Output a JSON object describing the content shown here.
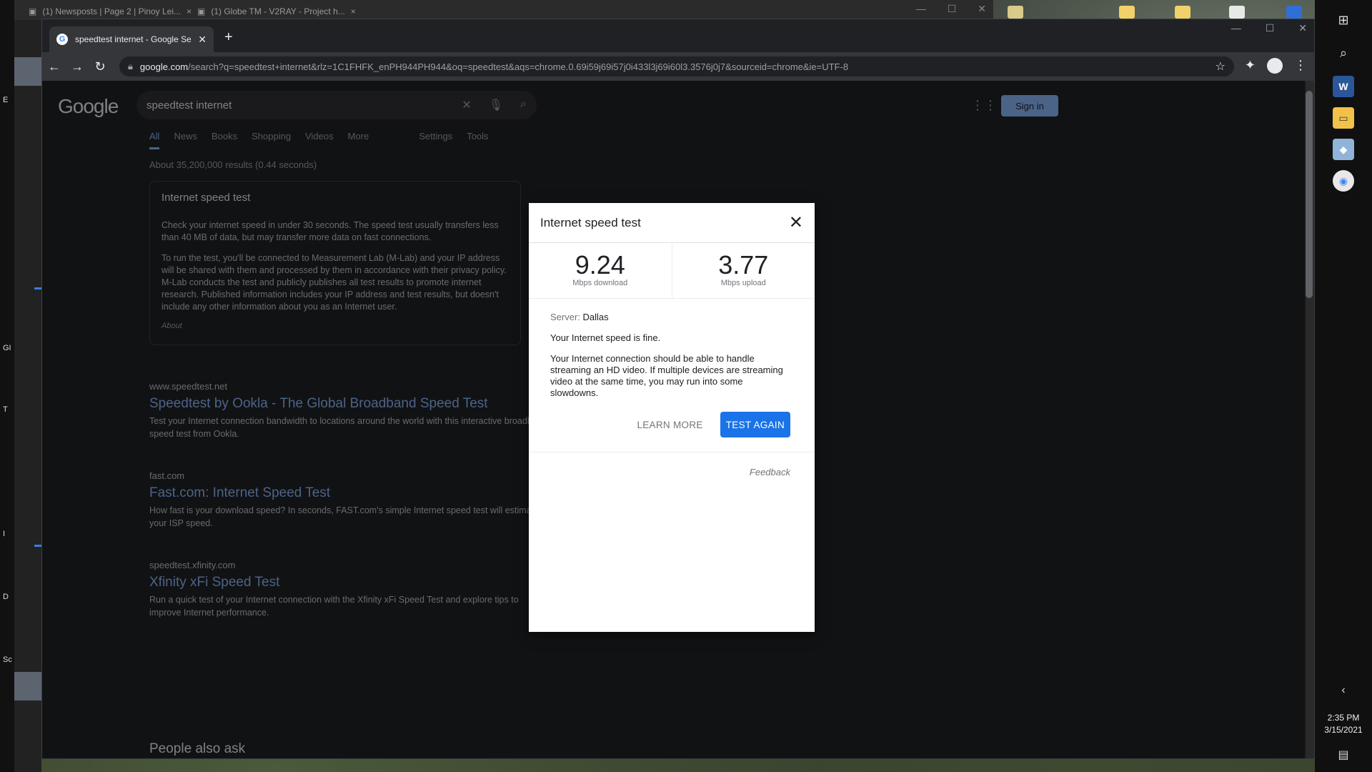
{
  "background_window": {
    "tabs": [
      "(1) Newsposts | Page 2 | Pinoy Lei...",
      "(1) Globe TM - V2RAY - Project h..."
    ]
  },
  "desktop_labels": [
    "E",
    "GI",
    "T",
    "I",
    "D",
    "Sc"
  ],
  "browser": {
    "tab_title": "speedtest internet - Google Search",
    "url_host": "google.com",
    "url_path": "/search?q=speedtest+internet&rlz=1C1FHFK_enPH944PH944&oq=speedtest&aqs=chrome.0.69i59j69i57j0i433l3j69i60l3.3576j0j7&sourceid=chrome&ie=UTF-8"
  },
  "google": {
    "logo": "Google",
    "query": "speedtest internet",
    "sign_in": "Sign in",
    "tabs": [
      "All",
      "News",
      "Books",
      "Shopping",
      "Videos",
      "More"
    ],
    "tools": [
      "Settings",
      "Tools"
    ],
    "stats": "About 35,200,000 results (0.44 seconds)",
    "card": {
      "title": "Internet speed test",
      "p1": "Check your internet speed in under 30 seconds. The speed test usually transfers less than 40 MB of data, but may transfer more data on fast connections.",
      "p2": "To run the test, you'll be connected to Measurement Lab (M-Lab) and your IP address will be shared with them and processed by them in accordance with their privacy policy. M-Lab conducts the test and publicly publishes all test results to promote internet research. Published information includes your IP address and test results, but doesn't include any other information about you as an Internet user.",
      "about": "About"
    },
    "results": [
      {
        "url": "www.speedtest.net",
        "title": "Speedtest by Ookla - The Global Broadband Speed Test",
        "snippet": "Test your Internet connection bandwidth to locations around the world with this interactive broadband speed test from Ookla."
      },
      {
        "url": "fast.com",
        "title": "Fast.com: Internet Speed Test",
        "snippet": "How fast is your download speed? In seconds, FAST.com's simple Internet speed test will estimate your ISP speed."
      },
      {
        "url": "speedtest.xfinity.com",
        "title": "Xfinity xFi Speed Test",
        "snippet": "Run a quick test of your Internet connection with the Xfinity xFi Speed Test and explore tips to improve Internet performance."
      }
    ],
    "people_also_ask": "People also ask"
  },
  "speedtest_modal": {
    "title": "Internet speed test",
    "download_value": "9.24",
    "download_unit": "Mbps download",
    "upload_value": "3.77",
    "upload_unit": "Mbps upload",
    "server_label": "Server:",
    "server_name": "Dallas",
    "verdict": "Your Internet speed is fine.",
    "details": "Your Internet connection should be able to handle streaming an HD video. If multiple devices are streaming video at the same time, you may run into some slowdowns.",
    "learn_more": "LEARN MORE",
    "test_again": "TEST AGAIN",
    "feedback": "Feedback"
  },
  "taskbar": {
    "time": "2:35 PM",
    "date": "3/15/2021"
  },
  "colors": {
    "accent_button": "#1a73e8",
    "chrome_dark": "#202124",
    "modal_bg": "#ffffff"
  }
}
